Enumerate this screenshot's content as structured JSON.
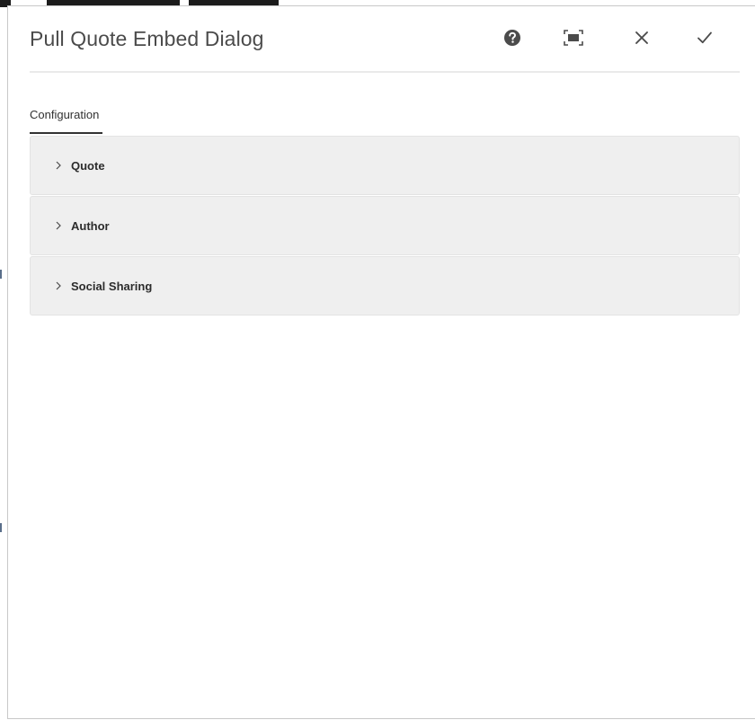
{
  "dialog": {
    "title": "Pull Quote Embed Dialog",
    "actions": [
      {
        "name": "help",
        "icon": "help-icon"
      },
      {
        "name": "fullscreen",
        "icon": "fullscreen-icon"
      },
      {
        "name": "close",
        "icon": "close-icon"
      },
      {
        "name": "done",
        "icon": "checkmark-icon"
      }
    ]
  },
  "tabs": [
    {
      "label": "Configuration",
      "active": true
    }
  ],
  "accordion": {
    "items": [
      {
        "label": "Quote",
        "expanded": false,
        "icon": "chevron-right-icon"
      },
      {
        "label": "Author",
        "expanded": false,
        "icon": "chevron-right-icon"
      },
      {
        "label": "Social Sharing",
        "expanded": false,
        "icon": "chevron-right-icon"
      }
    ]
  },
  "colors": {
    "title_text": "#4b4b4b",
    "panel_background": "#efefef",
    "panel_border": "#e3e3e3",
    "tab_underline": "#323232",
    "icon_color": "#4b4b4b"
  }
}
